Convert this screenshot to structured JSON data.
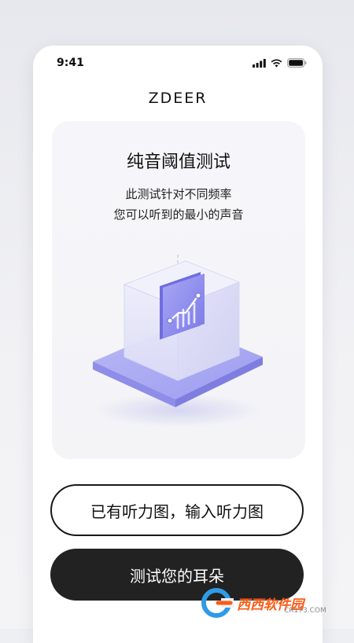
{
  "status_bar": {
    "time": "9:41"
  },
  "app": {
    "title": "ZDEER"
  },
  "card": {
    "heading": "纯音阈值测试",
    "desc_line1": "此测试针对不同频率",
    "desc_line2": "您可以听到的最小的声音"
  },
  "actions": {
    "enter_audiogram_label": "已有听力图，输入听力图",
    "test_ears_label": "测试您的耳朵"
  },
  "watermark": {
    "brand": "西西软件园",
    "site": "CR173.COM"
  },
  "colors": {
    "primary_button": "#222222",
    "accent_purple": "#8f8ef0",
    "watermark_orange": "#ff5a14"
  }
}
